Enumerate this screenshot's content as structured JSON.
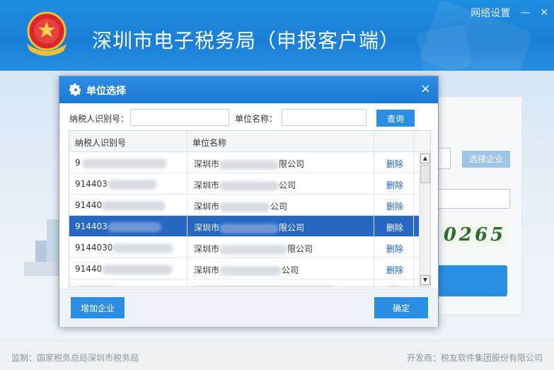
{
  "app": {
    "title": "深圳市电子税务局（申报客户端）",
    "network_settings": "网络设置",
    "minimize": "—",
    "close": "✕",
    "select_enterprise": "选择企业",
    "captcha": "0265"
  },
  "footer": {
    "supervisor": "监制：国家税务总局深圳市税务局",
    "developer": "开发商：税友软件集团股份有限公司"
  },
  "dialog": {
    "title": "单位选择",
    "close": "×",
    "search": {
      "taxpayer_id_label": "纳税人识别号：",
      "taxpayer_id_value": "",
      "unit_name_label": "单位名称：",
      "unit_name_value": "",
      "query_button": "查询"
    },
    "table": {
      "columns": [
        "纳税人识别号",
        "单位名称",
        ""
      ],
      "rows": [
        {
          "id": "9",
          "name_prefix": "深圳市",
          "name_suffix": "限公司",
          "action": "删除",
          "selected": false
        },
        {
          "id": "914403",
          "name_prefix": "深圳市",
          "name_suffix": "公司",
          "action": "删除",
          "selected": false
        },
        {
          "id": "91440",
          "name_prefix": "深圳市",
          "name_suffix": "公司",
          "action": "删除",
          "selected": false
        },
        {
          "id": "914403",
          "name_prefix": "深圳市",
          "name_suffix": "限公司",
          "action": "删除",
          "selected": true
        },
        {
          "id": "9144030",
          "name_prefix": "深圳市",
          "name_suffix": "限公司",
          "action": "删除",
          "selected": false
        },
        {
          "id": "91440",
          "name_prefix": "深圳市",
          "name_suffix": "公司",
          "action": "删除",
          "selected": false
        }
      ]
    },
    "add_button": "增加企业",
    "ok_button": "确定"
  },
  "colors": {
    "header_blue": "#1c8de0",
    "selected_row": "#2667c1",
    "button_blue": "#2a8ee3",
    "link_blue": "#1a64c8"
  }
}
